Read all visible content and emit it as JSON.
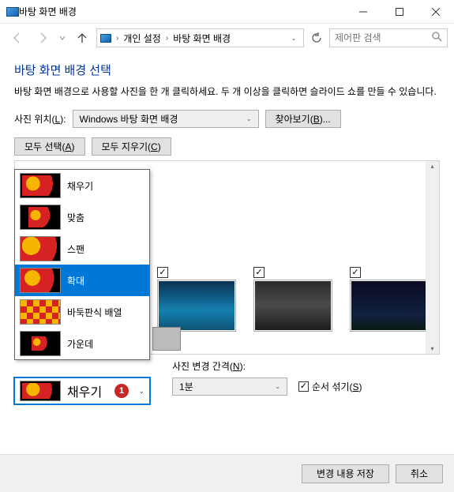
{
  "window": {
    "title": "바탕 화면 배경"
  },
  "addressbar": {
    "item1": "개인 설정",
    "item2": "바탕 화면 배경"
  },
  "search": {
    "placeholder": "제어판 검색"
  },
  "page": {
    "title": "바탕 화면 배경 선택",
    "description": "바탕 화면 배경으로 사용할 사진을 한 개 클릭하세요. 두 개 이상을 클릭하면 슬라이드 쇼를 만들 수 있습니다."
  },
  "location": {
    "label_pre": "사진 위치(",
    "label_accel": "L",
    "label_post": "):",
    "value": "Windows 바탕 화면 배경",
    "browse_pre": "찾아보기(",
    "browse_accel": "B",
    "browse_post": ")..."
  },
  "select_buttons": {
    "all_pre": "모두 선택(",
    "all_accel": "A",
    "all_post": ")",
    "clear_pre": "모두 지우기(",
    "clear_accel": "C",
    "clear_post": ")"
  },
  "fit_options": [
    {
      "label": "채우기",
      "selected": false
    },
    {
      "label": "맞춤",
      "selected": false
    },
    {
      "label": "스팬",
      "selected": false
    },
    {
      "label": "확대",
      "selected": true
    },
    {
      "label": "바둑판식 배열",
      "selected": false
    },
    {
      "label": "가운데",
      "selected": false
    }
  ],
  "fit_combo": {
    "value": "채우기",
    "badge": "1"
  },
  "interval": {
    "label_pre": "사진 변경 간격(",
    "label_accel": "N",
    "label_post": "):",
    "value": "1분",
    "shuffle_pre": "순서 섞기(",
    "shuffle_accel": "S",
    "shuffle_post": ")",
    "shuffle_checked": true
  },
  "thumbnails": [
    {
      "checked": true
    },
    {
      "checked": true
    },
    {
      "checked": true
    }
  ],
  "footer": {
    "save": "변경 내용 저장",
    "cancel": "취소"
  }
}
